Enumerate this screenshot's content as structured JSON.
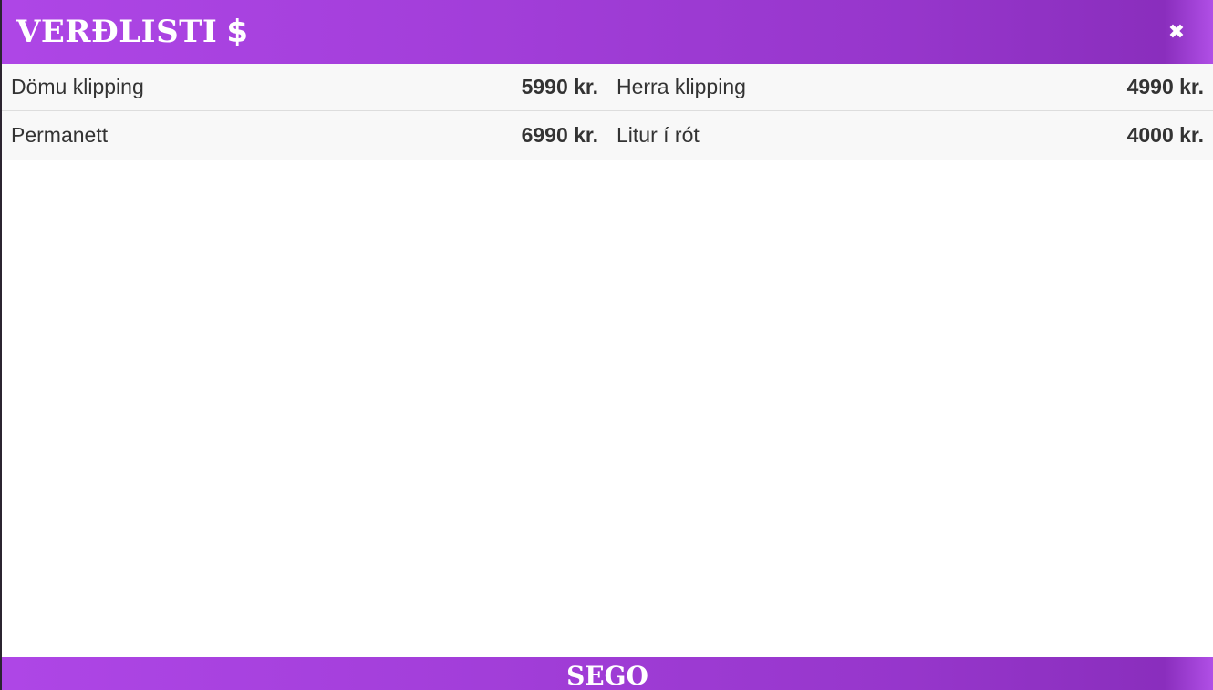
{
  "header": {
    "title": "VERÐLISTI",
    "dollar_icon": "$",
    "close_icon": "✖"
  },
  "prices": [
    {
      "name": "Dömu klipping",
      "price": "5990 kr."
    },
    {
      "name": "Herra klipping",
      "price": "4990 kr."
    },
    {
      "name": "Permanett",
      "price": "6990 kr."
    },
    {
      "name": "Litur í rót",
      "price": "4000 kr."
    }
  ],
  "footer": {
    "brand": "SEGO"
  },
  "colors": {
    "accent_purple": "#a23ed9",
    "row_background": "#f8f8f8",
    "text": "#333333"
  }
}
